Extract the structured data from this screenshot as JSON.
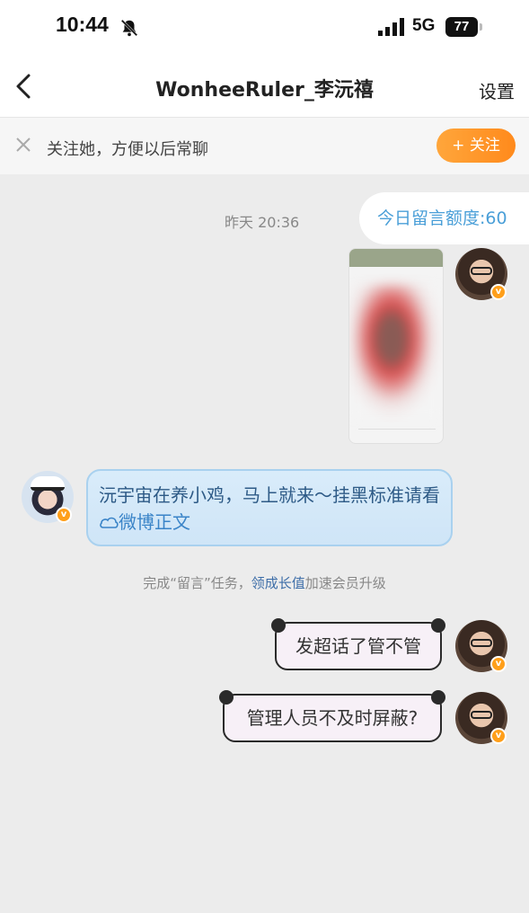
{
  "status_bar": {
    "time": "10:44",
    "network": "5G",
    "battery": "77"
  },
  "nav": {
    "title": "WonheeRuler_李沅禧",
    "settings_label": "设置"
  },
  "follow_bar": {
    "prompt": "关注她，方便以后常聊",
    "follow_label": "+ 关注"
  },
  "chat": {
    "timestamp": "昨天 20:36",
    "quota": "今日留言额度:60",
    "other_message_text": "沅宇宙在养小鸡，马上就来～挂黑标准请看",
    "other_message_link": "微博正文",
    "hint_prefix": "完成“留言”任务，",
    "hint_link": "领成长值",
    "hint_suffix": "加速会员升级",
    "my_messages": [
      "发超话了管不管",
      "管理人员不及时屏蔽?"
    ]
  }
}
